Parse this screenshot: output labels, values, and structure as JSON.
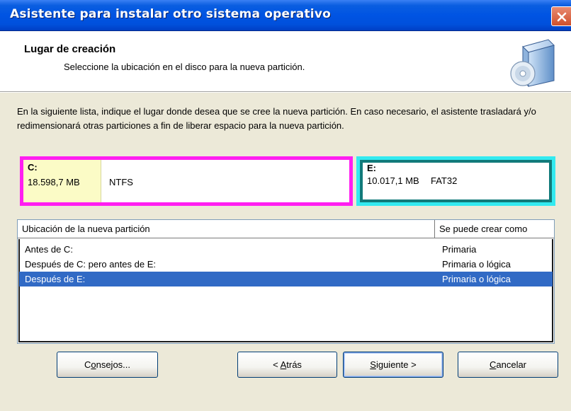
{
  "window": {
    "title": "Asistente para instalar otro sistema operativo"
  },
  "header": {
    "title": "Lugar de creación",
    "subtitle": "Seleccione la ubicación en el disco para la nueva partición."
  },
  "description": "En la siguiente lista, indique el lugar donde desea que se cree la nueva partición. En caso necesario, el asistente trasladará y/o redimensionará otras particiones a fin de liberar espacio para la nueva partición.",
  "partitions": [
    {
      "name": "C:",
      "size": "18.598,7 MB",
      "fs": "NTFS",
      "color": "#ff1ef1"
    },
    {
      "name": "E:",
      "size": "10.017,1 MB",
      "fs": "FAT32",
      "color": "#33eaf0"
    }
  ],
  "table": {
    "columns": [
      "Ubicación de la nueva partición",
      "Se puede crear como"
    ],
    "rows": [
      {
        "location": "Antes de C:",
        "type": "Primaria",
        "selected": false
      },
      {
        "location": "Después de C:  pero antes de E:",
        "type": "Primaria o lógica",
        "selected": false
      },
      {
        "location": "Después de E:",
        "type": "Primaria o lógica",
        "selected": true
      }
    ],
    "selection_color": "#316ac5"
  },
  "buttons": {
    "consejos_pre": "C",
    "consejos_acc": "o",
    "consejos_post": "nsejos...",
    "atras_pre": "< ",
    "atras_acc": "A",
    "atras_post": "trás",
    "siguiente_pre": "",
    "siguiente_acc": "S",
    "siguiente_post": "iguiente >",
    "cancelar_pre": "",
    "cancelar_acc": "C",
    "cancelar_post": "ancelar"
  },
  "icons": {
    "close": "close-icon",
    "setup": "install-disc-icon"
  },
  "colors": {
    "titlebar": "#0054e3",
    "dialog_bg": "#ece9d8"
  }
}
